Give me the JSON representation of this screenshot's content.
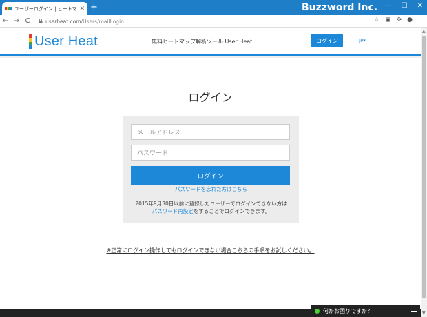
{
  "browser": {
    "tab_title": "ユーザーログイン | ヒートマップ解析ツー",
    "tab_close": "✕",
    "new_tab": "+",
    "brand_overlay": "Buzzword Inc.",
    "window_buttons": [
      "—",
      "☐",
      "✕"
    ],
    "url_host": "userheat.com",
    "url_path": "/Users/mailLogin",
    "nav": {
      "back": "←",
      "forward": "→",
      "reload": "C"
    },
    "toolbar_icons": [
      "star-icon",
      "extension-icon",
      "puzzle-icon",
      "profile-icon",
      "menu-icon"
    ]
  },
  "header": {
    "logo_text": "User Heat",
    "logo_colors": [
      "#e53935",
      "#fbc02d",
      "#43a047",
      "#1e88d8"
    ],
    "tagline": "無料ヒートマップ解析ツール User Heat",
    "login_button": "ログイン",
    "language": "JP▾"
  },
  "login": {
    "title": "ログイン",
    "email_placeholder": "メールアドレス",
    "password_placeholder": "パスワード",
    "submit_label": "ログイン",
    "forgot_link": "パスワードを忘れた方はこちら",
    "notice_line1": "2015年9月30日以前に登録したユーザーでログインできない方は",
    "notice_link": "パスワード再設定",
    "notice_line2_suffix": "をすることでログインできます。"
  },
  "help_link": "※正常にログイン操作してもログインできない場合こちらの手順をお試しください。",
  "chat": {
    "label": "何かお困りですか？"
  },
  "colors": {
    "accent": "#1e88d8",
    "chrome": "#1e7ec8"
  }
}
